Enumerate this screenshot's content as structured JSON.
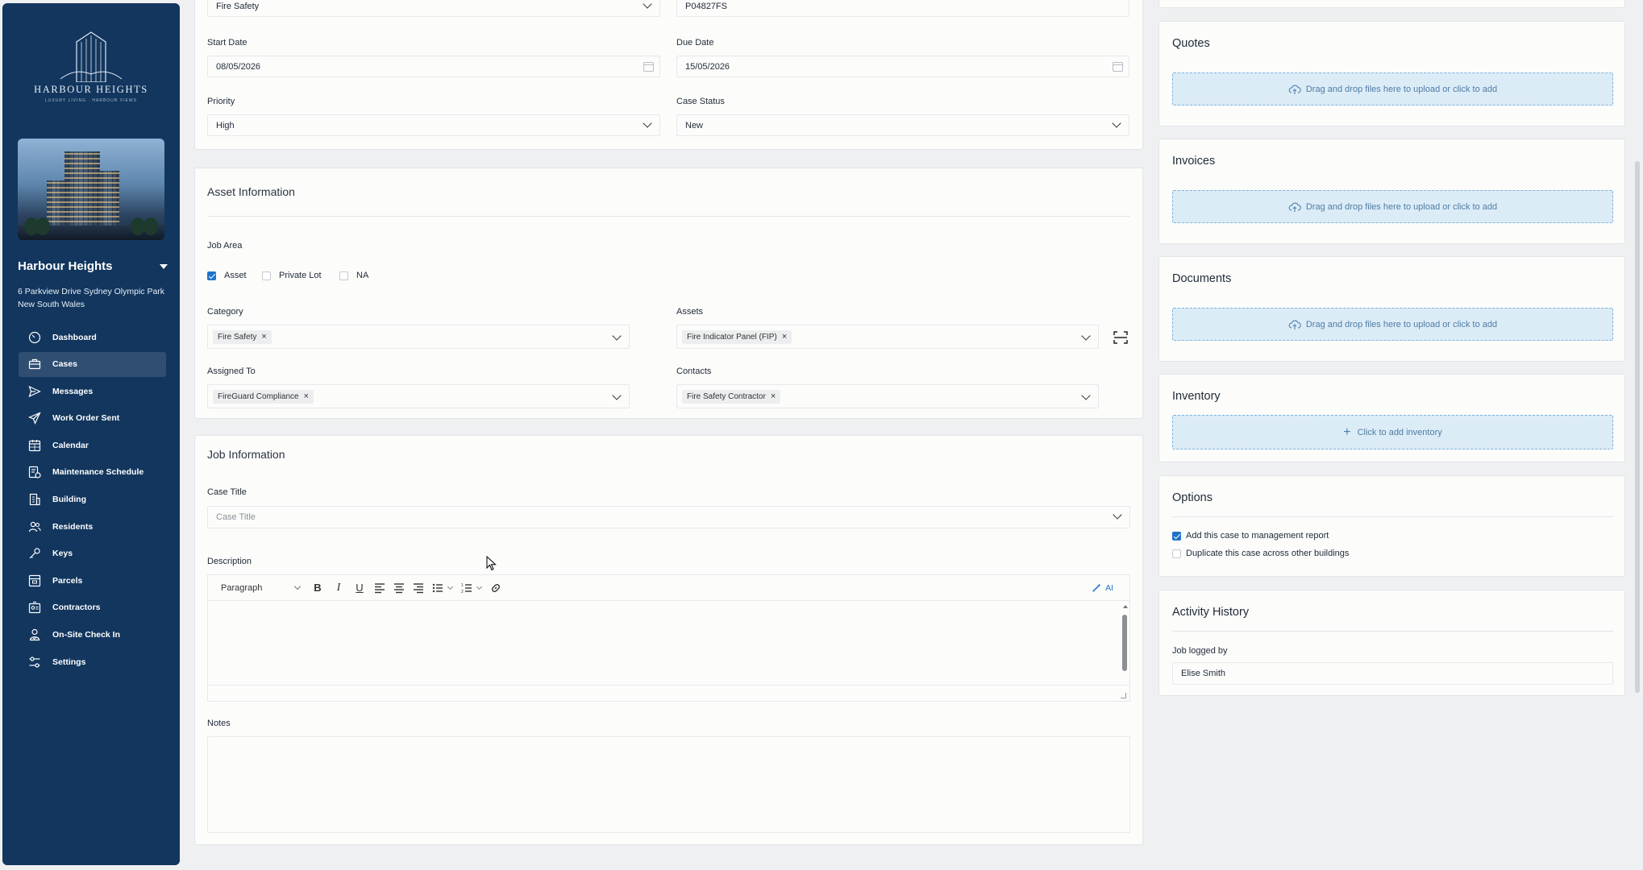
{
  "sidebar": {
    "logo_text": "HARBOUR HEIGHTS",
    "logo_sub": "LUXURY LIVING · HARBOUR VIEWS",
    "property_name": "Harbour Heights",
    "property_address": "6 Parkview Drive Sydney Olympic Park New South Wales",
    "nav": [
      {
        "label": "Dashboard",
        "icon": "dashboard-icon",
        "active": false
      },
      {
        "label": "Cases",
        "icon": "briefcase-icon",
        "active": true
      },
      {
        "label": "Messages",
        "icon": "send-icon",
        "active": false
      },
      {
        "label": "Work Order Sent",
        "icon": "paper-plane-icon",
        "active": false
      },
      {
        "label": "Calendar",
        "icon": "calendar-icon",
        "active": false
      },
      {
        "label": "Maintenance Schedule",
        "icon": "schedule-icon",
        "active": false
      },
      {
        "label": "Building",
        "icon": "building-icon",
        "active": false
      },
      {
        "label": "Residents",
        "icon": "users-icon",
        "active": false
      },
      {
        "label": "Keys",
        "icon": "key-icon",
        "active": false
      },
      {
        "label": "Parcels",
        "icon": "parcel-icon",
        "active": false
      },
      {
        "label": "Contractors",
        "icon": "contractor-icon",
        "active": false
      },
      {
        "label": "On-Site Check In",
        "icon": "check-in-icon",
        "active": false
      },
      {
        "label": "Settings",
        "icon": "settings-icon",
        "active": false
      }
    ]
  },
  "top_form": {
    "category_value": "Fire Safety",
    "po_value": "P04827FS",
    "start_date_label": "Start Date",
    "start_date_value": "08/05/2026",
    "due_date_label": "Due Date",
    "due_date_value": "15/05/2026",
    "priority_label": "Priority",
    "priority_value": "High",
    "case_status_label": "Case Status",
    "case_status_value": "New"
  },
  "asset_info": {
    "title": "Asset Information",
    "job_area_label": "Job Area",
    "job_area_options": [
      {
        "label": "Asset",
        "checked": true
      },
      {
        "label": "Private Lot",
        "checked": false
      },
      {
        "label": "NA",
        "checked": false
      }
    ],
    "category_label": "Category",
    "category_tag": "Fire Safety",
    "assets_label": "Assets",
    "assets_tag": "Fire Indicator Panel (FIP)",
    "assigned_to_label": "Assigned To",
    "assigned_to_tag": "FireGuard Compliance",
    "contacts_label": "Contacts",
    "contacts_tag": "Fire Safety Contractor"
  },
  "job_info": {
    "title": "Job Information",
    "case_title_label": "Case Title",
    "case_title_placeholder": "Case Title",
    "description_label": "Description",
    "paragraph_select": "Paragraph",
    "ai_label": "AI",
    "notes_label": "Notes"
  },
  "right_panel": {
    "quotes_title": "Quotes",
    "invoices_title": "Invoices",
    "documents_title": "Documents",
    "dropzone_text": "Drag and drop files here to upload or click to add",
    "inventory_title": "Inventory",
    "inventory_text": "Click to add inventory",
    "options_title": "Options",
    "options": [
      {
        "label": "Add this case to management report",
        "checked": true
      },
      {
        "label": "Duplicate this case across other buildings",
        "checked": false
      }
    ],
    "activity_title": "Activity History",
    "job_logged_label": "Job logged by",
    "job_logged_value": "Elise Smith"
  },
  "colors": {
    "sidebar": "#12365e",
    "accent": "#1f73c9",
    "dropzone_bg": "#dcecf7"
  }
}
